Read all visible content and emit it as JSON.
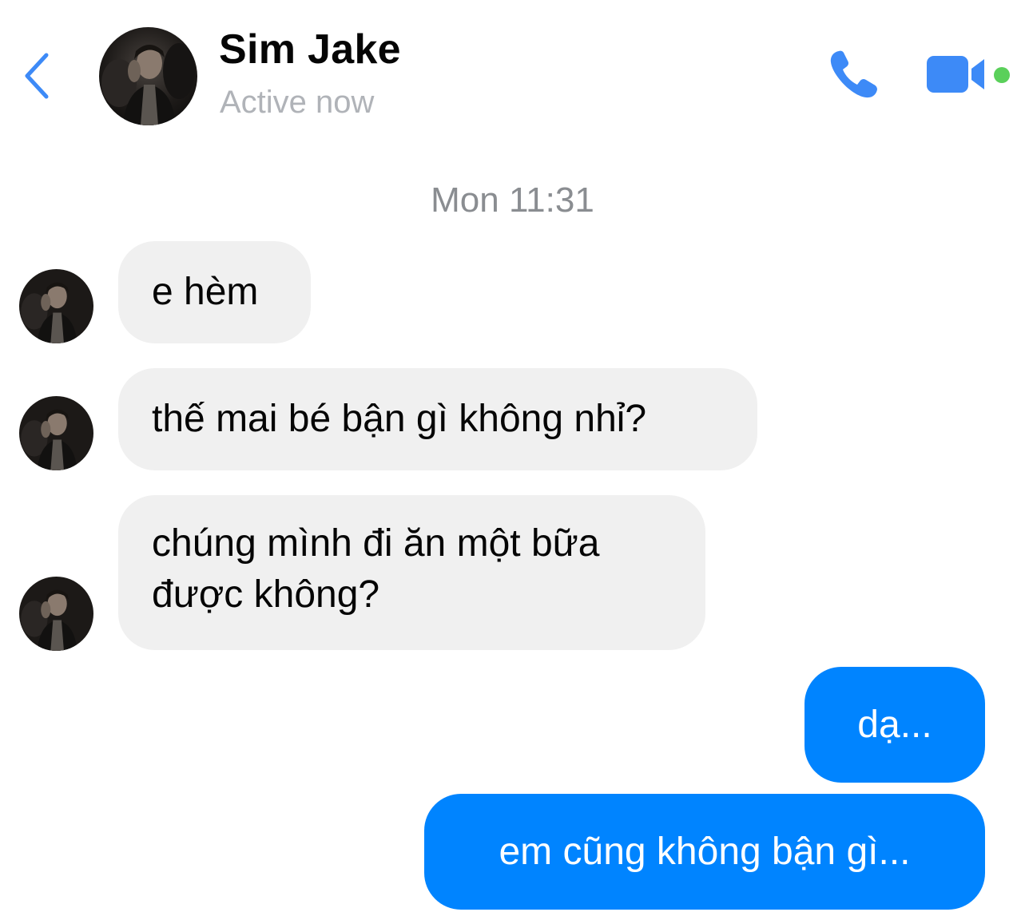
{
  "header": {
    "name": "Sim Jake",
    "status": "Active now",
    "icons": {
      "back": "chevron-left-icon",
      "call": "phone-icon",
      "video": "video-camera-icon"
    },
    "accent_color": "#3d8af7",
    "online_color": "#5ad05a"
  },
  "thread": {
    "timestamp": "Mon 11:31",
    "messages": [
      {
        "from": "Sim Jake",
        "text": "e hèm"
      },
      {
        "from": "Sim Jake",
        "text": "thế mai bé bận gì không nhỉ?"
      },
      {
        "from": "Sim Jake",
        "lines": [
          "chúng mình đi ăn một bữa",
          "được không?"
        ]
      },
      {
        "from": "me",
        "text": "dạ..."
      },
      {
        "from": "me",
        "text": "em cũng không bận gì..."
      }
    ]
  },
  "colors": {
    "incoming_bubble": "#f0f0f0",
    "outgoing_bubble": "#0084ff"
  }
}
